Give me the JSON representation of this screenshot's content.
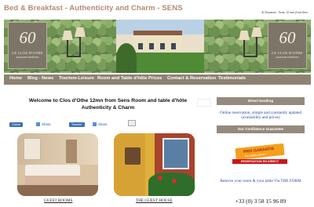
{
  "header": {
    "title": "Bed & Breakfast - Authenticity and Charm - SENS",
    "tagline": "At Soumont - Sens, 12 min from Sens"
  },
  "banner": {
    "logo_number": "60",
    "logo_name": "LE CLOS D'OTHE",
    "logo_subtitle": "MAISON D'HÔTES"
  },
  "nav": {
    "items": [
      "Home",
      "Blog - News",
      "Tourism-Leisure",
      "Room and Table d'hôte",
      "Prices",
      "Contact & Reservation",
      "Testimonials"
    ]
  },
  "main": {
    "heading_line1": "Welcome to Clos d'Othe 12mn from Sens Room and table d'hôte",
    "heading_line2": "Authenticity & Charm",
    "social": {
      "like": "J'aime",
      "share": "Share",
      "tweet": "Tweeter",
      "share2": "Share"
    },
    "captions": {
      "room": "GUEST ROOMS",
      "house": "THE GUEST HOUSE"
    }
  },
  "sidebar": {
    "direct_booking": "Direct booking",
    "booking_text": "Online reservation, simple and constantly updated (availability and prices)",
    "guarantee_button": "Our Confidence Guarantee",
    "badge_line1": "PRIX GARANTIS",
    "badge_line2": "les moins chers !",
    "badge_strip": "RESERVATION EN DIRECT",
    "reserve_text": "Reserve your room & your table Via THE FORM",
    "phone": "+33 (0) 3 58 15 96 89"
  },
  "colors": {
    "title": "#b48a72",
    "nav_bg": "#8e8272",
    "sidebar_button": "#958a7d",
    "link_blue": "#2a46a8"
  }
}
